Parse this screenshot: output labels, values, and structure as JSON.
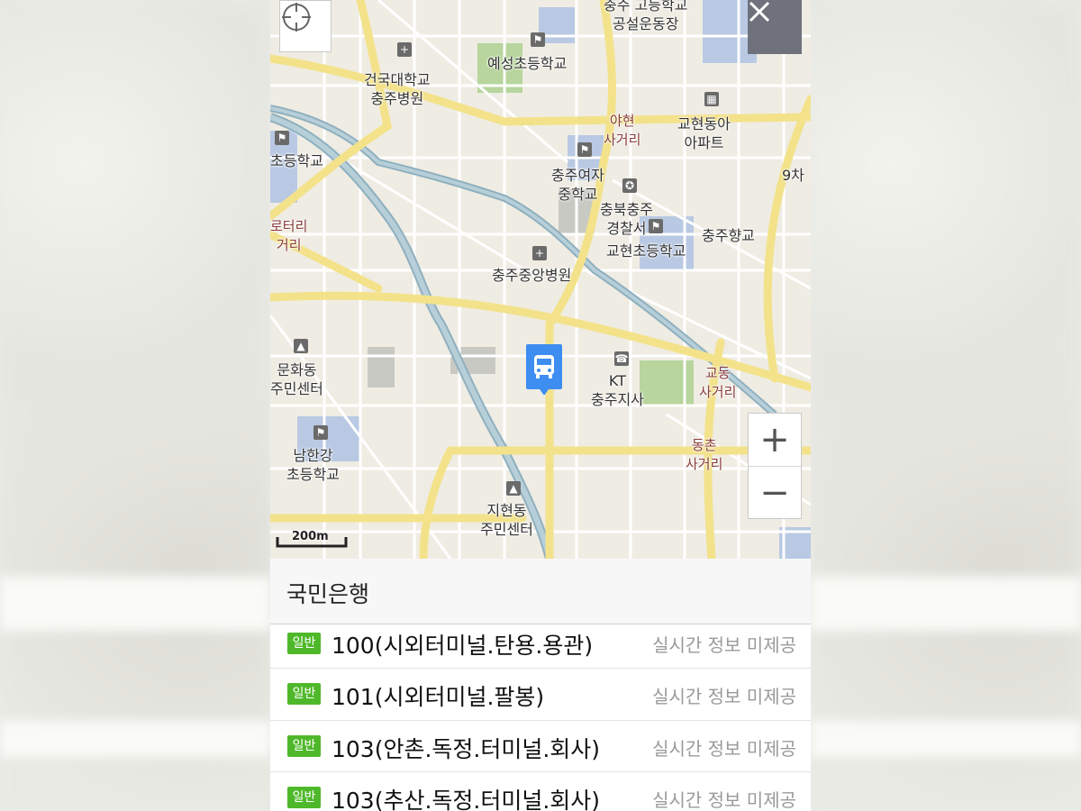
{
  "map": {
    "labels": {
      "school_top": "충주 고등학교\n공설운동장",
      "yeseong": "예성초등학교",
      "konkuk": "건국대학교\n충주병원",
      "yahyeon": "야현\n사거리",
      "gyohyeon_apt": "교현동아\n아파트",
      "left_school": "초등학교",
      "chaa": "9차",
      "chungju_girls": "충주여자\n중학교",
      "police": "충북충주\n경찰서",
      "gyohyeon_elem": "교현초등학교",
      "hyanggyo": "충주향교",
      "rotary": "로터리\n거리",
      "central_hospital": "충주중앙병원",
      "munhwa": "문화동\n주민센터",
      "kt": "KT\n충주지사",
      "gyodong": "교동\n사거리",
      "namhangang": "남한강\n초등학교",
      "dongchon": "동촌\n사거리",
      "jihyeon": "지현동\n주민센터"
    },
    "scale_label": "200m",
    "close_icon": "close-icon",
    "locate_icon": "crosshair-icon",
    "zoom_in": "+",
    "zoom_out": "−",
    "marker_icon": "bus-icon",
    "marker_color": "#3d8ef0"
  },
  "stop": {
    "name": "국민은행"
  },
  "routes": [
    {
      "badge": "일반",
      "name": "100(시외터미널.탄용.용관)",
      "status": "실시간 정보 미제공"
    },
    {
      "badge": "일반",
      "name": "101(시외터미널.팔봉)",
      "status": "실시간 정보 미제공"
    },
    {
      "badge": "일반",
      "name": "103(안촌.독정.터미널.회사)",
      "status": "실시간 정보 미제공"
    },
    {
      "badge": "일반",
      "name": "103(추산.독정.터미널.회사)",
      "status": "실시간 정보 미제공"
    }
  ],
  "colors": {
    "badge": "#4fb82a",
    "close_button": "#6f727c",
    "status_text": "#9a9a9a"
  }
}
